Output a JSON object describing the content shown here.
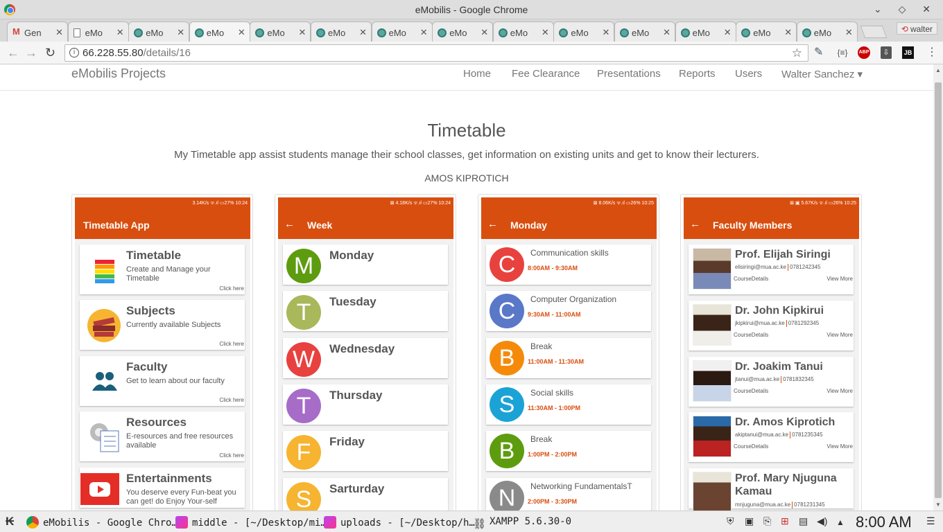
{
  "window": {
    "title": "eMobilis - Google Chrome",
    "controls": "⌄ ◇ ✕"
  },
  "tabs": [
    {
      "label": "Gen",
      "icon": "gmail-icon"
    },
    {
      "label": "eMo",
      "icon": "doc-icon"
    },
    {
      "label": "eMo",
      "icon": "emobilis-favicon"
    },
    {
      "label": "eMo",
      "icon": "emobilis-favicon",
      "active": true
    },
    {
      "label": "eMo",
      "icon": "emobilis-favicon"
    },
    {
      "label": "eMo",
      "icon": "emobilis-favicon"
    },
    {
      "label": "eMo",
      "icon": "emobilis-favicon"
    },
    {
      "label": "eMo",
      "icon": "emobilis-favicon"
    },
    {
      "label": "eMo",
      "icon": "emobilis-favicon"
    },
    {
      "label": "eMo",
      "icon": "emobilis-favicon"
    },
    {
      "label": "eMo",
      "icon": "emobilis-favicon"
    },
    {
      "label": "eMo",
      "icon": "emobilis-favicon"
    },
    {
      "label": "eMo",
      "icon": "emobilis-favicon"
    },
    {
      "label": "eMo",
      "icon": "emobilis-favicon"
    }
  ],
  "profile": {
    "label": "walter"
  },
  "toolbar": {
    "url_host": "66.228.55.80",
    "url_path": "/details/16",
    "ext_abp": "ABP",
    "ext_jb": "JB",
    "ext_json": "{≡}"
  },
  "site": {
    "brand": "eMobilis Projects",
    "nav": [
      "Home",
      "Fee Clearance",
      "Presentations",
      "Reports",
      "Users",
      "Walter Sanchez ▾"
    ]
  },
  "project": {
    "title": "Timetable",
    "description": "My Timetable app assist students manage their school classes, get information on existing units and get to know their lecturers.",
    "author": "AMOS KIPROTICH"
  },
  "screens": {
    "home": {
      "status": "3.14K/s ᯤ.ıl ▭27% 10:24",
      "appbar": "Timetable App",
      "items": [
        {
          "title": "Timetable",
          "sub": "Create and Manage your Timetable",
          "click": "Click here"
        },
        {
          "title": "Subjects",
          "sub": "Currently available Subjects",
          "click": "Click here"
        },
        {
          "title": "Faculty",
          "sub": "Get to learn about our faculty",
          "click": "Click here"
        },
        {
          "title": "Resources",
          "sub": "E-resources and free resources available",
          "click": "Click here"
        },
        {
          "title": "Entertainments",
          "sub": "You deserve every Fun-beat you can get! do Enjoy Your-self",
          "click": ""
        }
      ]
    },
    "week": {
      "status": "⊠ 4.18K/s ᯤ.ıl ▭27% 10:24",
      "appbar": "Week",
      "days": [
        {
          "letter": "M",
          "name": "Monday",
          "color": "#5e9c0f"
        },
        {
          "letter": "T",
          "name": "Tuesday",
          "color": "#a8b85a"
        },
        {
          "letter": "W",
          "name": "Wednesday",
          "color": "#e8423f"
        },
        {
          "letter": "T",
          "name": "Thursday",
          "color": "#a66cc8"
        },
        {
          "letter": "F",
          "name": "Friday",
          "color": "#f6b431"
        },
        {
          "letter": "S",
          "name": "Sarturday",
          "color": "#f6b431"
        }
      ]
    },
    "monday": {
      "status": "⊠ 8.06K/s ᯤ.ıl ▭26% 10:25",
      "appbar": "Monday",
      "lessons": [
        {
          "letter": "C",
          "name": "Communication skills",
          "time": "8:00AM - 9:30AM",
          "color": "#e8423f"
        },
        {
          "letter": "C",
          "name": "Computer Organization",
          "time": "9:30AM - 11:00AM",
          "color": "#5a78c8"
        },
        {
          "letter": "B",
          "name": "Break",
          "time": "11:00AM - 11:30AM",
          "color": "#f58a0a"
        },
        {
          "letter": "S",
          "name": "Social skills",
          "time": "11:30AM - 1:00PM",
          "color": "#1ba3d6"
        },
        {
          "letter": "B",
          "name": "Break",
          "time": "1:00PM - 2:00PM",
          "color": "#5e9c0f"
        },
        {
          "letter": "N",
          "name": "Networking FundamentalsT",
          "time": "2:00PM - 3:30PM",
          "color": "#8a8a8a"
        }
      ]
    },
    "faculty": {
      "status": "⊠ ▣ 5.67K/s ᯤ.ıl ▭26% 10:25",
      "appbar": "Faculty Members",
      "members": [
        {
          "name": "Prof. Elijah Siringi",
          "email": "elisiringi@mua.ac.ke",
          "phone": "0781242345",
          "details": "CourseDetails",
          "more": "View More"
        },
        {
          "name": "Dr. John Kipkirui",
          "email": "jkipkirui@mua.ac.ke",
          "phone": "0781292345",
          "details": "CourseDetails",
          "more": "View More"
        },
        {
          "name": "Dr. Joakim Tanui",
          "email": "jtanui@mua.ac.ke",
          "phone": "0781832345",
          "details": "CourseDetails",
          "more": "View More"
        },
        {
          "name": "Dr. Amos Kiprotich",
          "email": "akiptanui@mua.ac.ke",
          "phone": "0781235345",
          "details": "CourseDetails",
          "more": "View More"
        },
        {
          "name": "Prof. Mary Njuguna Kamau",
          "email": "mnjuguna@mua.ac.ke",
          "phone": "0781231345",
          "details": "",
          "more": ""
        }
      ]
    }
  },
  "taskbar": {
    "items": [
      "eMobilis - Google Chro…",
      "middle - [~/Desktop/mi…",
      "uploads - [~/Desktop/h…",
      "XAMPP 5.6.30-0"
    ],
    "clock": "8:00 AM"
  }
}
